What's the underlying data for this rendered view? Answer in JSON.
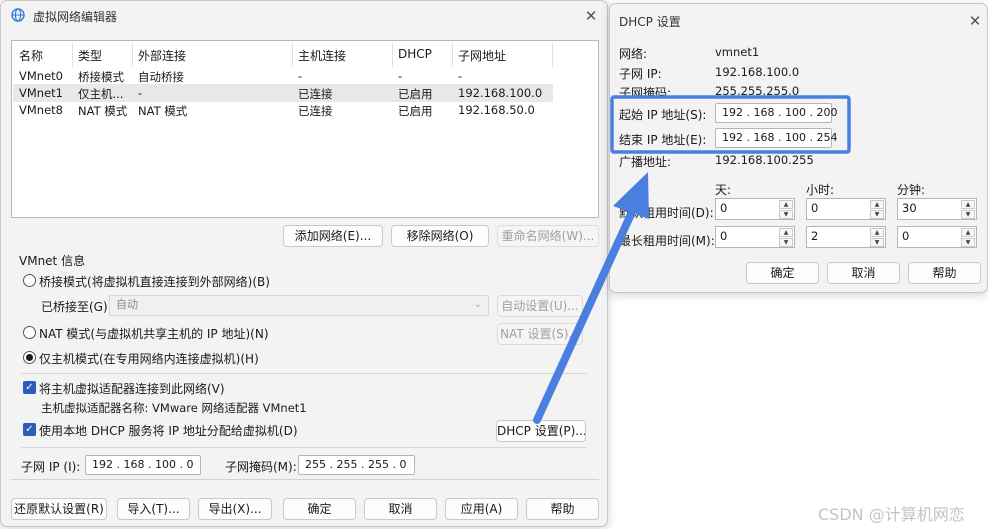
{
  "main_window": {
    "title": "虚拟网络编辑器",
    "table": {
      "headers": [
        "名称",
        "类型",
        "外部连接",
        "主机连接",
        "DHCP",
        "子网地址"
      ],
      "rows": [
        [
          "VMnet0",
          "桥接模式",
          "自动桥接",
          "-",
          "-",
          "-"
        ],
        [
          "VMnet1",
          "仅主机...",
          "-",
          "已连接",
          "已启用",
          "192.168.100.0"
        ],
        [
          "VMnet8",
          "NAT 模式",
          "NAT 模式",
          "已连接",
          "已启用",
          "192.168.50.0"
        ]
      ]
    },
    "add_network": "添加网络(E)...",
    "remove_network": "移除网络(O)",
    "rename_network": "重命名网络(W)...",
    "vmnet_info": "VMnet 信息",
    "bridged_mode": "桥接模式(将虚拟机直接连接到外部网络)(B)",
    "bridged_to_label": "已桥接至(G):",
    "bridged_to_value": "自动",
    "auto_settings": "自动设置(U)...",
    "nat_mode": "NAT 模式(与虚拟机共享主机的 IP 地址)(N)",
    "nat_settings": "NAT 设置(S)...",
    "host_only_mode": "仅主机模式(在专用网络内连接虚拟机)(H)",
    "connect_adapter": "将主机虚拟适配器连接到此网络(V)",
    "adapter_name": "主机虚拟适配器名称: VMware 网络适配器 VMnet1",
    "use_dhcp": "使用本地 DHCP 服务将 IP 地址分配给虚拟机(D)",
    "dhcp_settings": "DHCP 设置(P)...",
    "subnet_ip_label": "子网 IP (I):",
    "subnet_ip": "192 . 168 . 100 . 0",
    "subnet_mask_label": "子网掩码(M):",
    "subnet_mask": "255 . 255 . 255 . 0",
    "restore_defaults": "还原默认设置(R)",
    "import": "导入(T)...",
    "export": "导出(X)...",
    "ok": "确定",
    "cancel": "取消",
    "apply": "应用(A)",
    "help": "帮助"
  },
  "dhcp_dialog": {
    "title": "DHCP 设置",
    "network_label": "网络:",
    "network_value": "vmnet1",
    "subnet_ip_label": "子网 IP:",
    "subnet_ip_value": "192.168.100.0",
    "subnet_mask_label": "子网掩码:",
    "subnet_mask_value": "255.255.255.0",
    "start_ip_label": "起始 IP 地址(S):",
    "start_ip_value": "192 . 168 . 100 . 200",
    "end_ip_label": "结束 IP 地址(E):",
    "end_ip_value": "192 . 168 . 100 . 254",
    "broadcast_label": "广播地址:",
    "broadcast_value": "192.168.100.255",
    "days": "天:",
    "hours": "小时:",
    "minutes": "分钟:",
    "default_lease_label": "默认租用时间(D):",
    "default_lease": [
      "0",
      "0",
      "30"
    ],
    "max_lease_label": "最长租用时间(M):",
    "max_lease": [
      "0",
      "2",
      "0"
    ],
    "ok": "确定",
    "cancel": "取消",
    "help": "帮助"
  },
  "watermark": "CSDN @计算机网恋",
  "colors": {
    "annotation": "#4a7fe0",
    "accent": "#2b5dbb"
  }
}
